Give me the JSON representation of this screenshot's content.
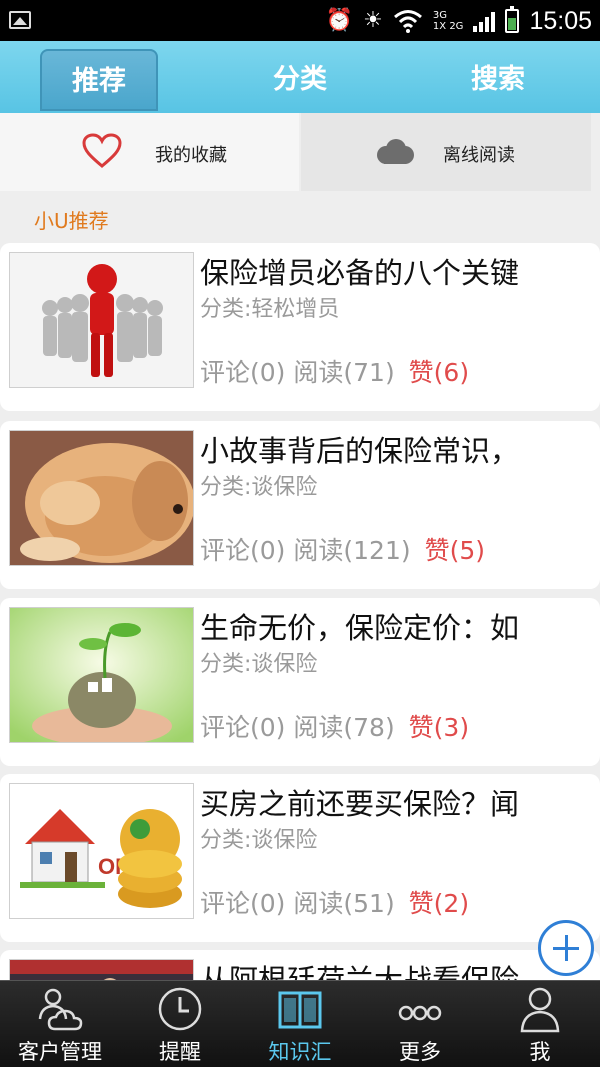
{
  "status_bar": {
    "time": "15:05",
    "network_top": "3G",
    "network_bottom": "1X",
    "network_bottom2": "2G"
  },
  "tabs": [
    {
      "label": "推荐",
      "active": true
    },
    {
      "label": "分类",
      "active": false
    },
    {
      "label": "搜索",
      "active": false
    }
  ],
  "quick_actions": {
    "favorites_label": "我的收藏",
    "offline_label": "离线阅读"
  },
  "section_title": "小U推荐",
  "articles": [
    {
      "title": "保险增员必备的八个关键",
      "category": "分类:轻松增员",
      "comments": "评论(0)",
      "reads": "阅读(71)",
      "likes": "赞(6)"
    },
    {
      "title": "小故事背后的保险常识，",
      "category": "分类:谈保险",
      "comments": "评论(0)",
      "reads": "阅读(121)",
      "likes": "赞(5)"
    },
    {
      "title": "生命无价，保险定价：如",
      "category": "分类:谈保险",
      "comments": "评论(0)",
      "reads": "阅读(78)",
      "likes": "赞(3)"
    },
    {
      "title": "买房之前还要买保险？闻",
      "category": "分类:谈保险",
      "comments": "评论(0)",
      "reads": "阅读(51)",
      "likes": "赞(2)"
    },
    {
      "title": "从阿根廷荷兰大战看保险",
      "category": "",
      "comments": "",
      "reads": "",
      "likes": ""
    }
  ],
  "bottom_nav": [
    {
      "label": "客户管理",
      "icon": "customer-management-icon"
    },
    {
      "label": "提醒",
      "icon": "clock-icon"
    },
    {
      "label": "知识汇",
      "icon": "book-icon",
      "active": true
    },
    {
      "label": "更多",
      "icon": "more-icon"
    },
    {
      "label": "我",
      "icon": "user-icon"
    }
  ],
  "colors": {
    "tab_bar": "#58c4e4",
    "accent_orange": "#e07a1e",
    "like_red": "#e04b4b",
    "active_nav": "#5bc8ee"
  }
}
